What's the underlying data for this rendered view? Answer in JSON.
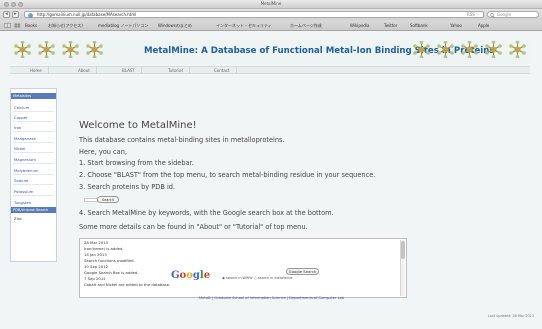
{
  "window": {
    "title": "MetalMine"
  },
  "browser": {
    "back_symbol": "◂",
    "forward_symbol": "▸",
    "url": "http://gomainium.nuil.jp/database/MAsearch.html",
    "rss": "RSS",
    "search_placeholder": "Google"
  },
  "bookmarks": [
    "Books",
    "お知らせ(アクセス)",
    "mediablog ノートパソコン",
    "Windowsのまとめ",
    "インターネット・セキュリティ",
    "ホームページ作成",
    "Wikipedia",
    "Twitter",
    "Softbank",
    "Yahoo",
    "Apple"
  ],
  "banner": {
    "title": "MetalMine: A Database of Functional Metal-Ion Binding Sites in Proteins",
    "icon_count_left": 4,
    "icon_count_right": 5
  },
  "menu": [
    "Home",
    "About",
    "BLAST",
    "Tutorial",
    "Contact"
  ],
  "sidebar": {
    "header1": "Metalsites",
    "items": [
      "Calcium",
      "Copper",
      "Iron",
      "Manganese",
      "Nickel",
      "Magnesium",
      "Molybdenum",
      "Sodium",
      "Potassium",
      "Tungsten"
    ],
    "header2": "PDB/Uniprot Search",
    "tail": "Zinc"
  },
  "content": {
    "heading": "Welcome to MetalMine!",
    "line1": "This database contains metal-binding sites in metalloproteins.",
    "line2": "Here, you can,",
    "step1": "1. Start browsing from the sidebar.",
    "step2": "2. Choose \"BLAST\" from the top menu, to search metal-binding residue in your sequence.",
    "step3": "3. Search proteins by PDB id.",
    "search_button": "Search",
    "step4": "4. Search MetalMine by keywords, with the Google search box at the bottom.",
    "more": "Some more details can be found in \"About\" or \"Tutorial\" of top menu."
  },
  "news": [
    "28 Mar 2013",
    "   Iron(heme) is added.",
    "14 Jan 2013",
    "   Search functions modified.",
    "10 Sep 2012",
    "   Google Search Box is added.",
    "7 Sep 2012",
    "   Cobalt and Nickel are added to the database."
  ],
  "google": {
    "logo": [
      "G",
      "o",
      "o",
      "g",
      "l",
      "e"
    ],
    "logo_colors": [
      "#3c64c8",
      "#d43c28",
      "#e8a818",
      "#3c64c8",
      "#2e9a3c",
      "#d43c28"
    ],
    "radio1": "search in WWW",
    "radio2": "search in metalmine",
    "button": "Google Search"
  },
  "footer": {
    "links": "MetaD | Graduate School of Information Science | Departments of Computer Lab",
    "last_updated": "Last updated: 28 Mar 2013"
  },
  "colors": {
    "accent": "#1f5f9a",
    "sidebar_header": "#5a7bb8",
    "link": "#3c4fb0"
  }
}
